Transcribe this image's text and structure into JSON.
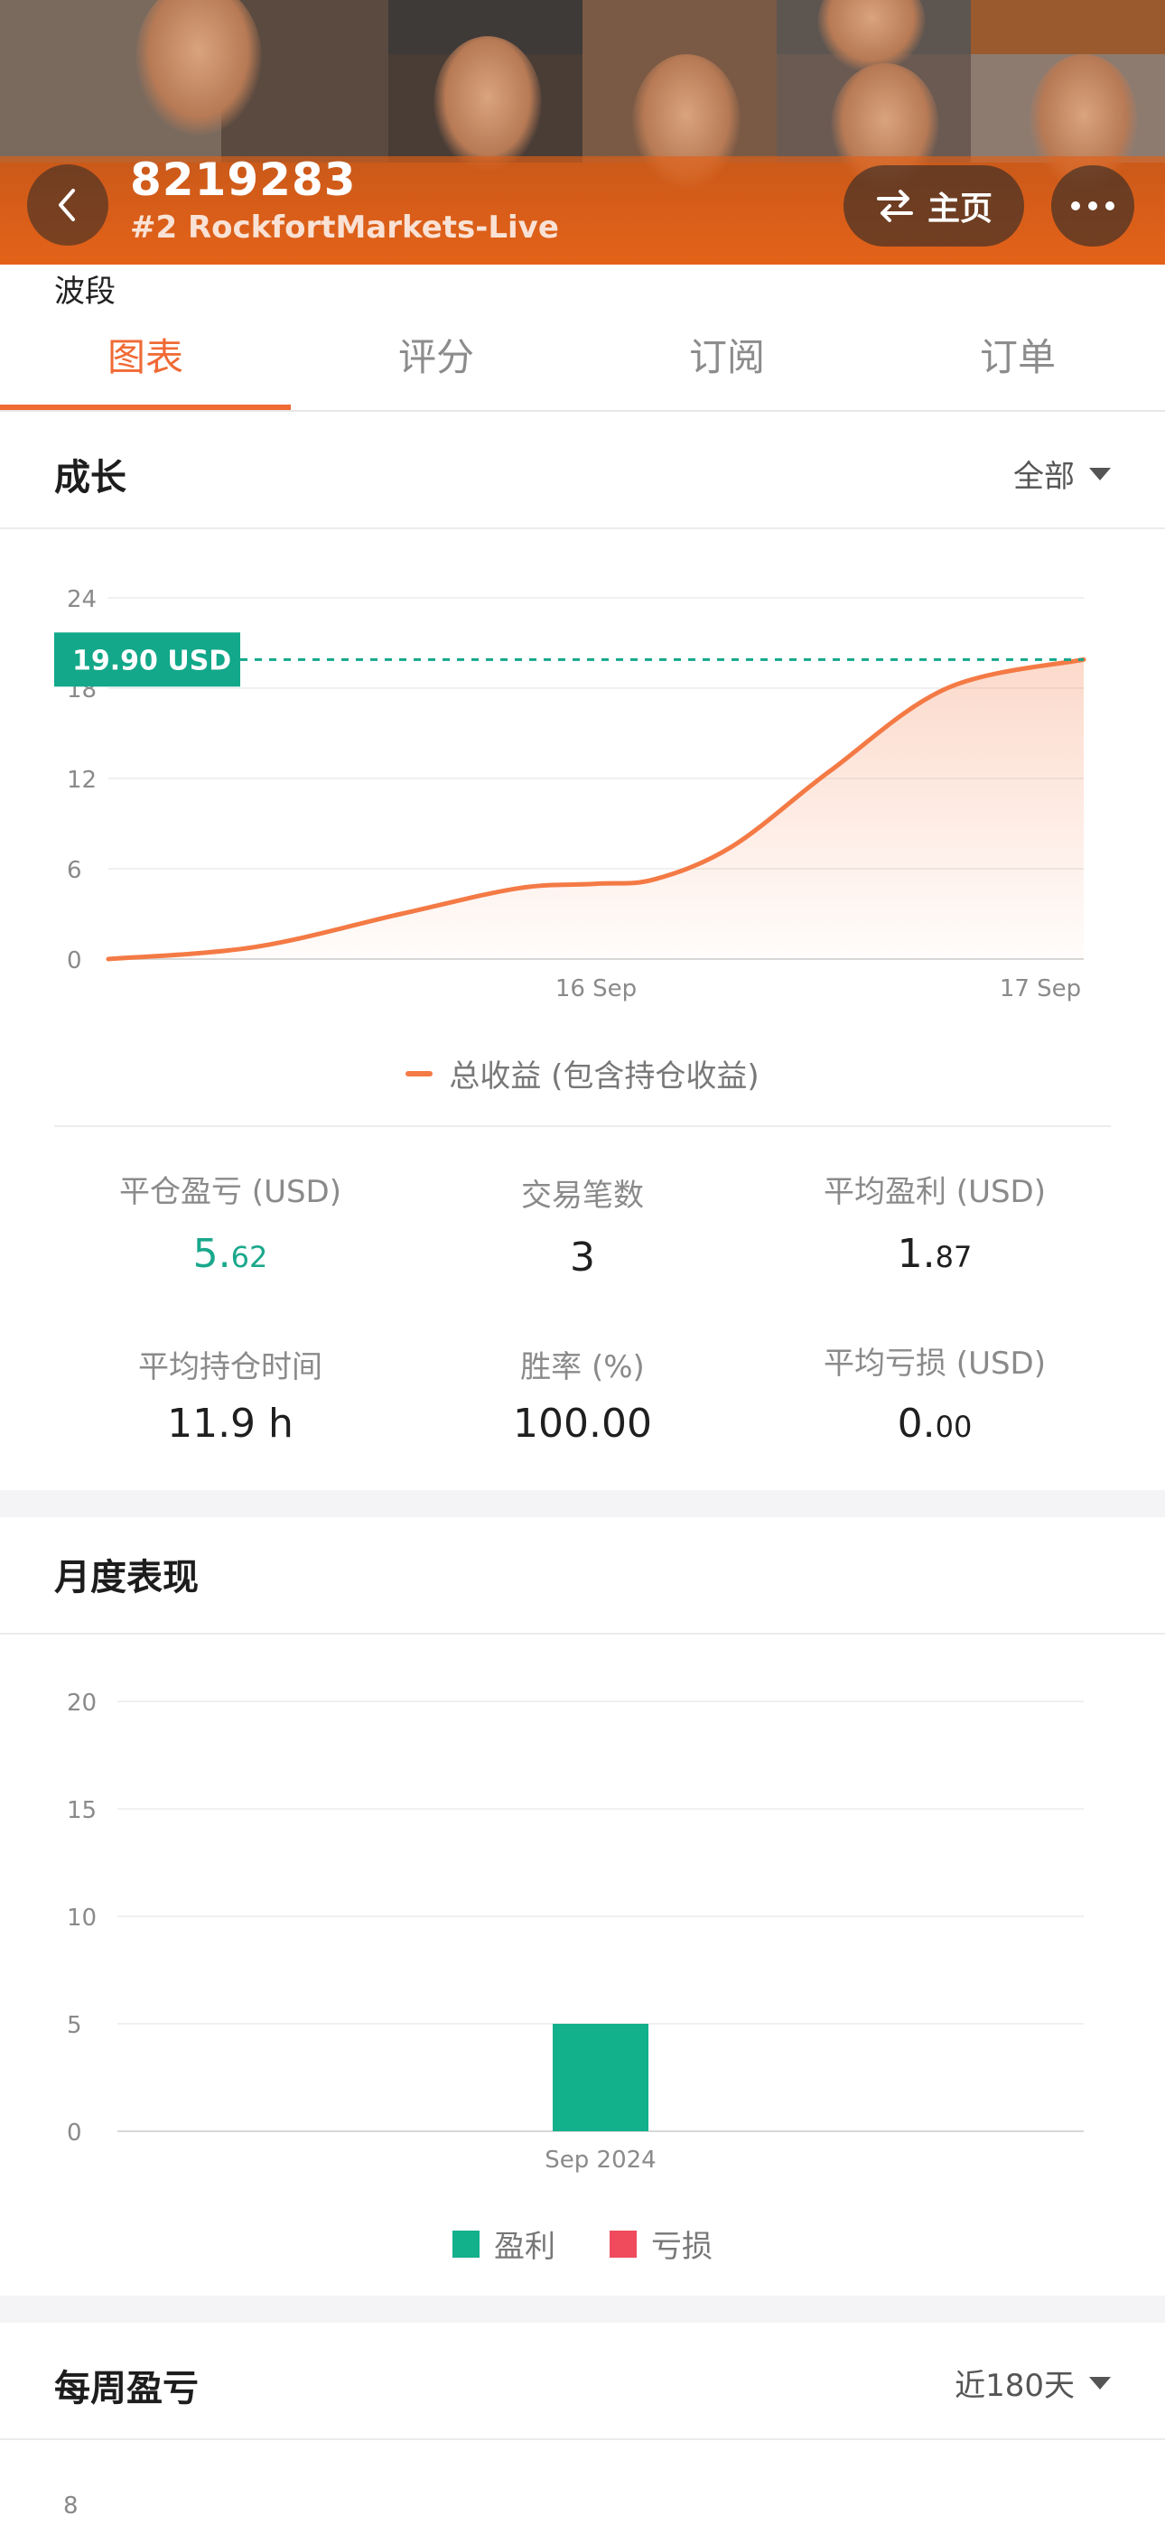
{
  "header": {
    "account_id": "8219283",
    "server": "#2 RockfortMarkets-Live",
    "home_label": "主页"
  },
  "strategy_label": "波段",
  "tabs": [
    {
      "label": "图表",
      "active": true
    },
    {
      "label": "评分",
      "active": false
    },
    {
      "label": "订阅",
      "active": false
    },
    {
      "label": "订单",
      "active": false
    }
  ],
  "growth": {
    "title": "成长",
    "filter": "全部",
    "current_badge": "19.90 USD",
    "legend": "总收益 (包含持仓收益)"
  },
  "stats": {
    "closed_pnl": {
      "label": "平仓盈亏 (USD)",
      "int": "5.",
      "dec": "62"
    },
    "trades": {
      "label": "交易笔数",
      "value": "3"
    },
    "avg_profit": {
      "label": "平均盈利 (USD)",
      "int": "1.",
      "dec": "87"
    },
    "avg_hold": {
      "label": "平均持仓时间",
      "value": "11.9 h"
    },
    "win_rate": {
      "label": "胜率 (%)",
      "value": "100.00"
    },
    "avg_loss": {
      "label": "平均亏损 (USD)",
      "int": "0.",
      "dec": "00"
    }
  },
  "monthly": {
    "title": "月度表现",
    "legend_profit": "盈利",
    "legend_loss": "亏损"
  },
  "weekly": {
    "title": "每周盈亏",
    "filter": "近180天",
    "first_tick": "8"
  },
  "colors": {
    "accent": "#f06a35",
    "profit": "#13b08c",
    "loss": "#ef4b5d",
    "line": "#f47a45"
  },
  "chart_data": [
    {
      "type": "area",
      "title": "成长",
      "x_ticks": [
        "16 Sep",
        "17 Sep"
      ],
      "y_ticks": [
        "0",
        "6",
        "12",
        "18",
        "24"
      ],
      "ylim": [
        0,
        24
      ],
      "series": [
        {
          "name": "总收益 (包含持仓收益)",
          "x": [
            0,
            0.15,
            0.3,
            0.42,
            0.5,
            0.56,
            0.64,
            0.74,
            0.86,
            1.0
          ],
          "values": [
            0,
            0.8,
            3.0,
            4.7,
            5.0,
            5.3,
            7.5,
            12.5,
            18.0,
            19.9
          ]
        }
      ],
      "reference_value": 19.9,
      "grid": true
    },
    {
      "type": "bar",
      "title": "月度表现",
      "categories": [
        "Sep 2024"
      ],
      "y_ticks": [
        "0",
        "5",
        "10",
        "15",
        "20"
      ],
      "ylim": [
        0,
        20
      ],
      "series": [
        {
          "name": "盈利",
          "values": [
            5.0
          ]
        },
        {
          "name": "亏损",
          "values": [
            0
          ]
        }
      ],
      "grid": true
    }
  ]
}
